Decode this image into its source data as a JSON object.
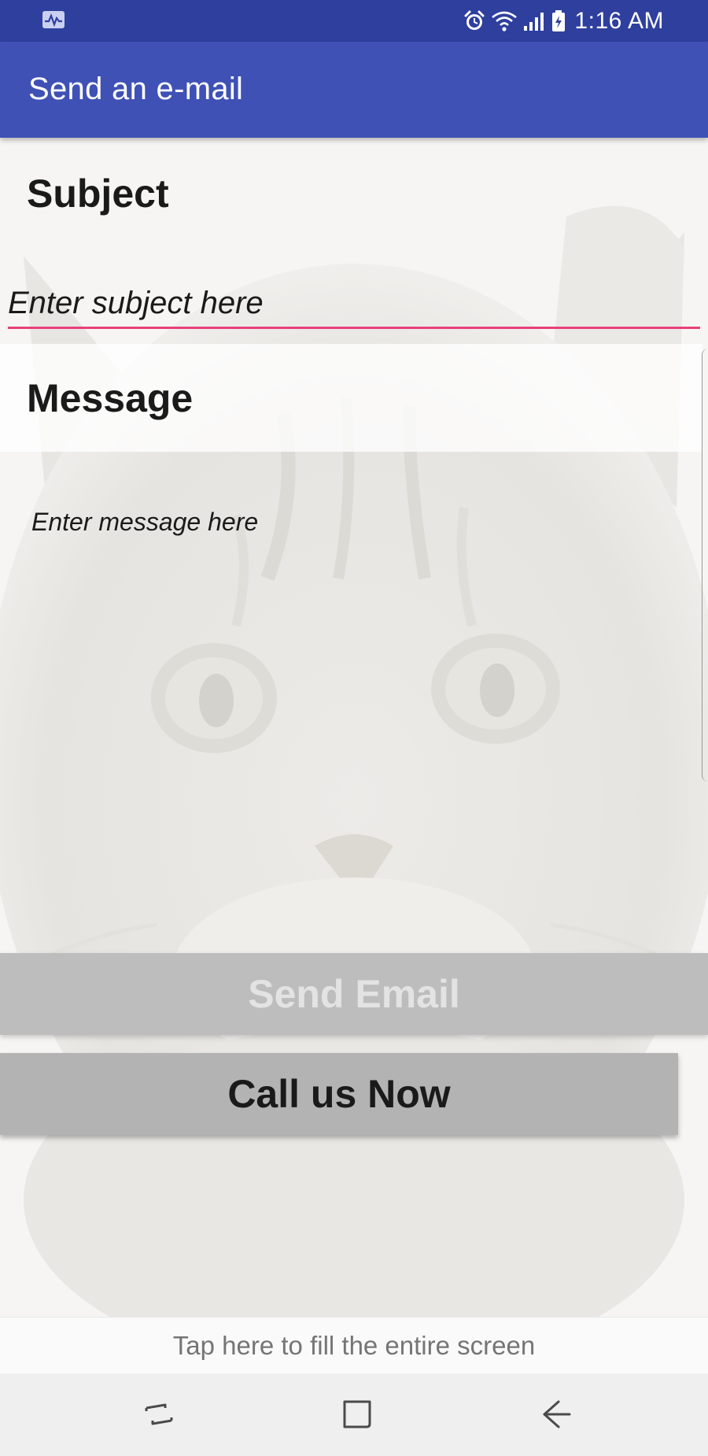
{
  "status_bar": {
    "time": "1:16 AM",
    "icons": [
      "activity-icon",
      "alarm-icon",
      "wifi-icon",
      "signal-icon",
      "battery-icon"
    ]
  },
  "app_bar": {
    "title": "Send an e-mail"
  },
  "form": {
    "subject_label": "Subject",
    "subject_placeholder": "Enter subject here",
    "message_label": "Message",
    "message_placeholder": "Enter message here"
  },
  "buttons": {
    "send_email": "Send Email",
    "call_us_now": "Call us Now"
  },
  "ad_banner": {
    "text": "Tap here to fill the entire screen"
  },
  "nav_bar": {
    "icons": [
      "recents-icon",
      "home-icon",
      "back-icon"
    ]
  },
  "colors": {
    "status_bar": "#2e3f9e",
    "app_bar": "#3f51b5",
    "accent_underline": "#e8407a",
    "button_gray": "#bdbdbd"
  }
}
